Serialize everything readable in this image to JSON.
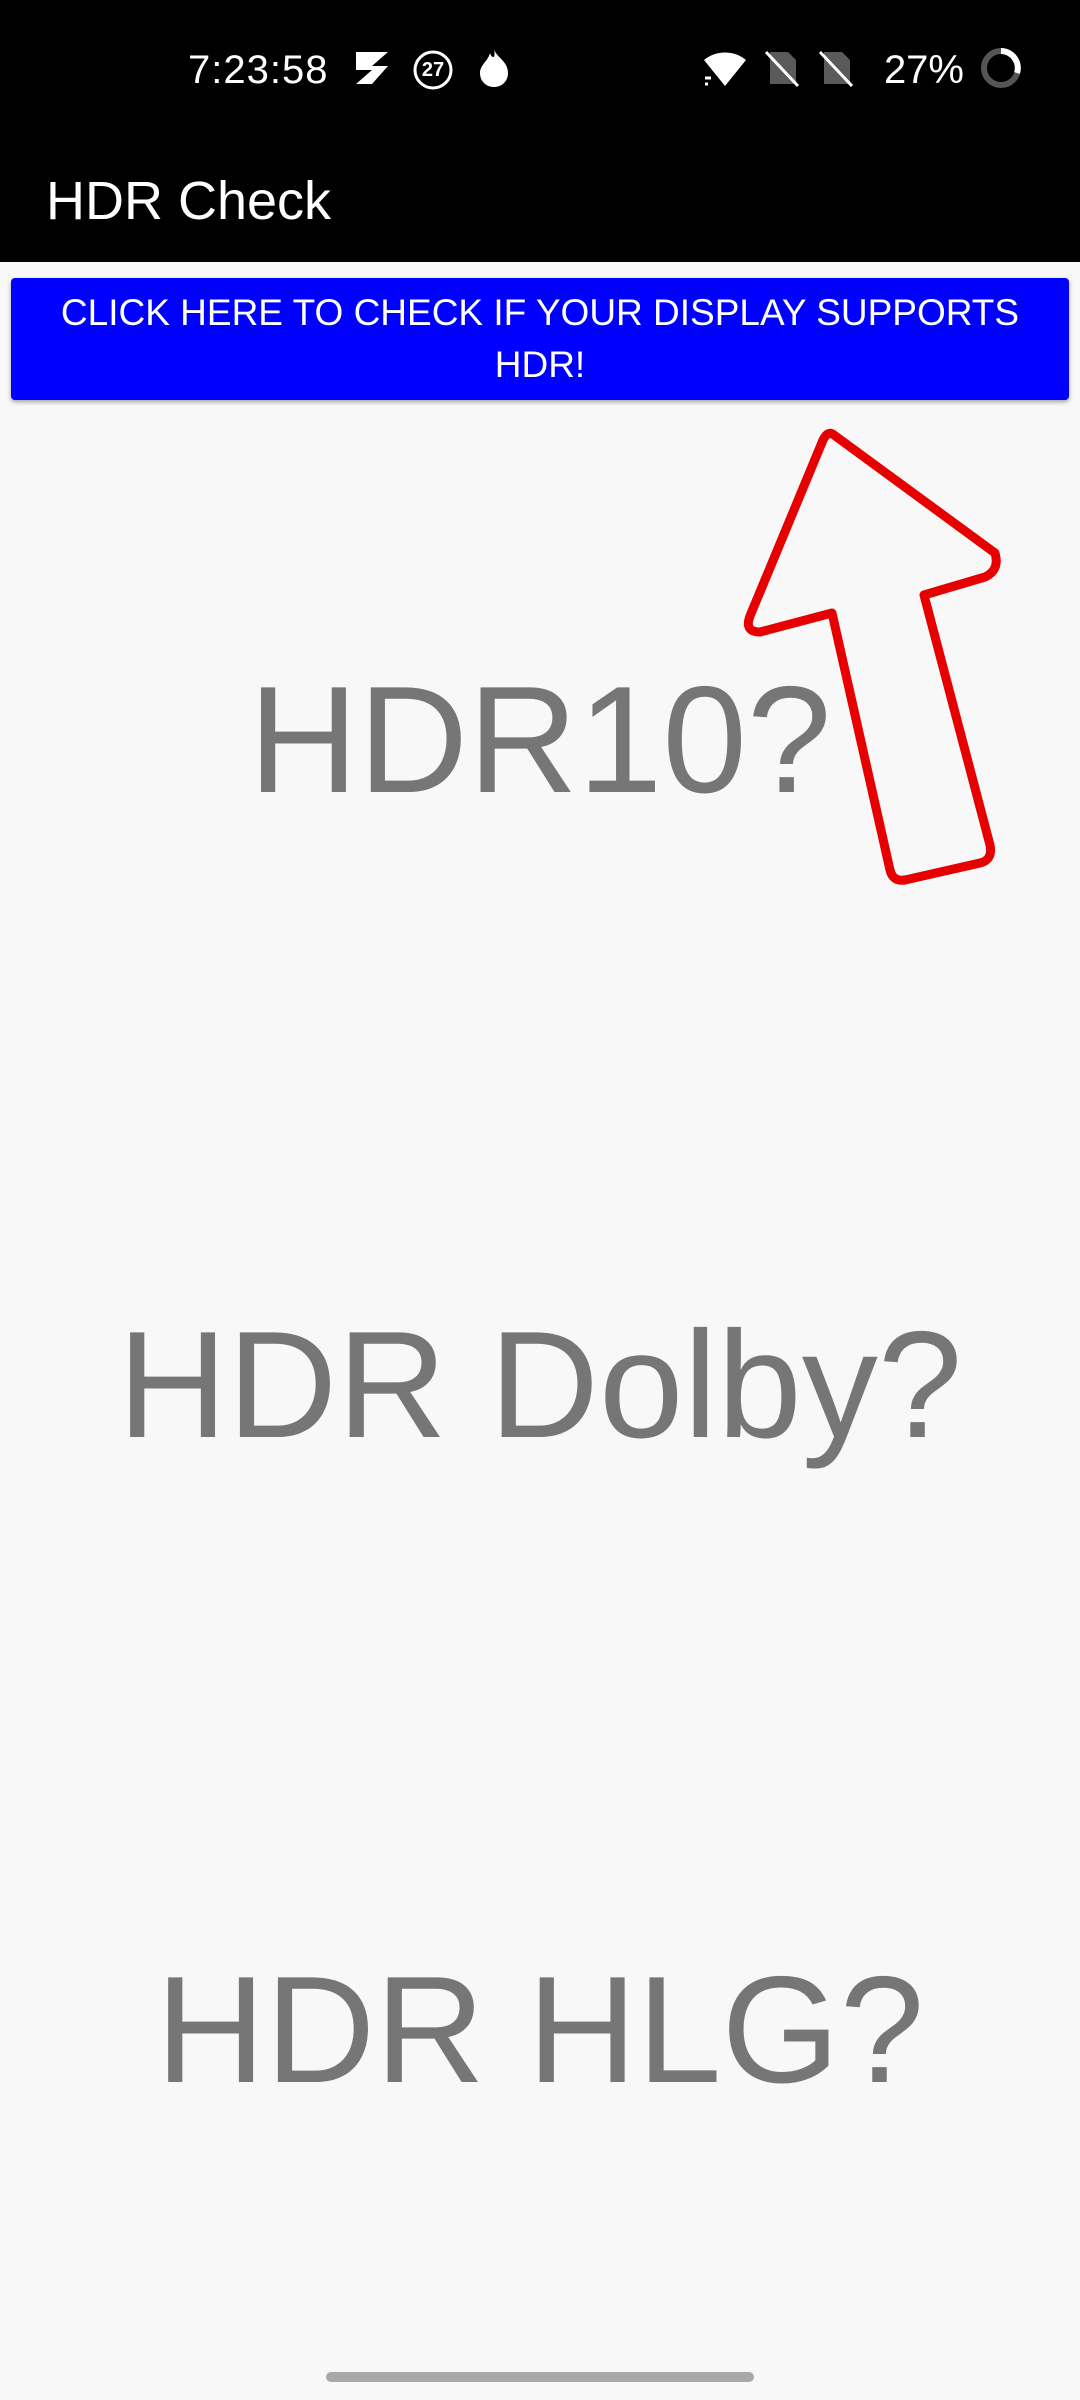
{
  "status_bar": {
    "time": "7:23:58",
    "notification_icons": [
      "s-logo-icon",
      "circle-27-icon",
      "flame-icon"
    ],
    "notification_badge": "27",
    "system_icons": [
      "wifi-icon",
      "sim-no-signal-icon",
      "sim-no-signal-icon"
    ],
    "battery_percent": "27%",
    "battery_icon": "battery-ring-icon"
  },
  "app_bar": {
    "title": "HDR Check"
  },
  "check_button": {
    "label": "CLICK HERE TO CHECK IF YOUR DISPLAY SUPPORTS HDR!"
  },
  "hdr_formats": [
    {
      "label": "HDR10?"
    },
    {
      "label": "HDR Dolby?"
    },
    {
      "label": "HDR HLG?"
    }
  ],
  "annotation": {
    "icon": "red-arrow-up-icon",
    "color": "#e60000"
  },
  "colors": {
    "button_blue": "#0000ff",
    "app_bar": "#000000",
    "background": "#f8f8f8",
    "label_gray": "#767676"
  }
}
